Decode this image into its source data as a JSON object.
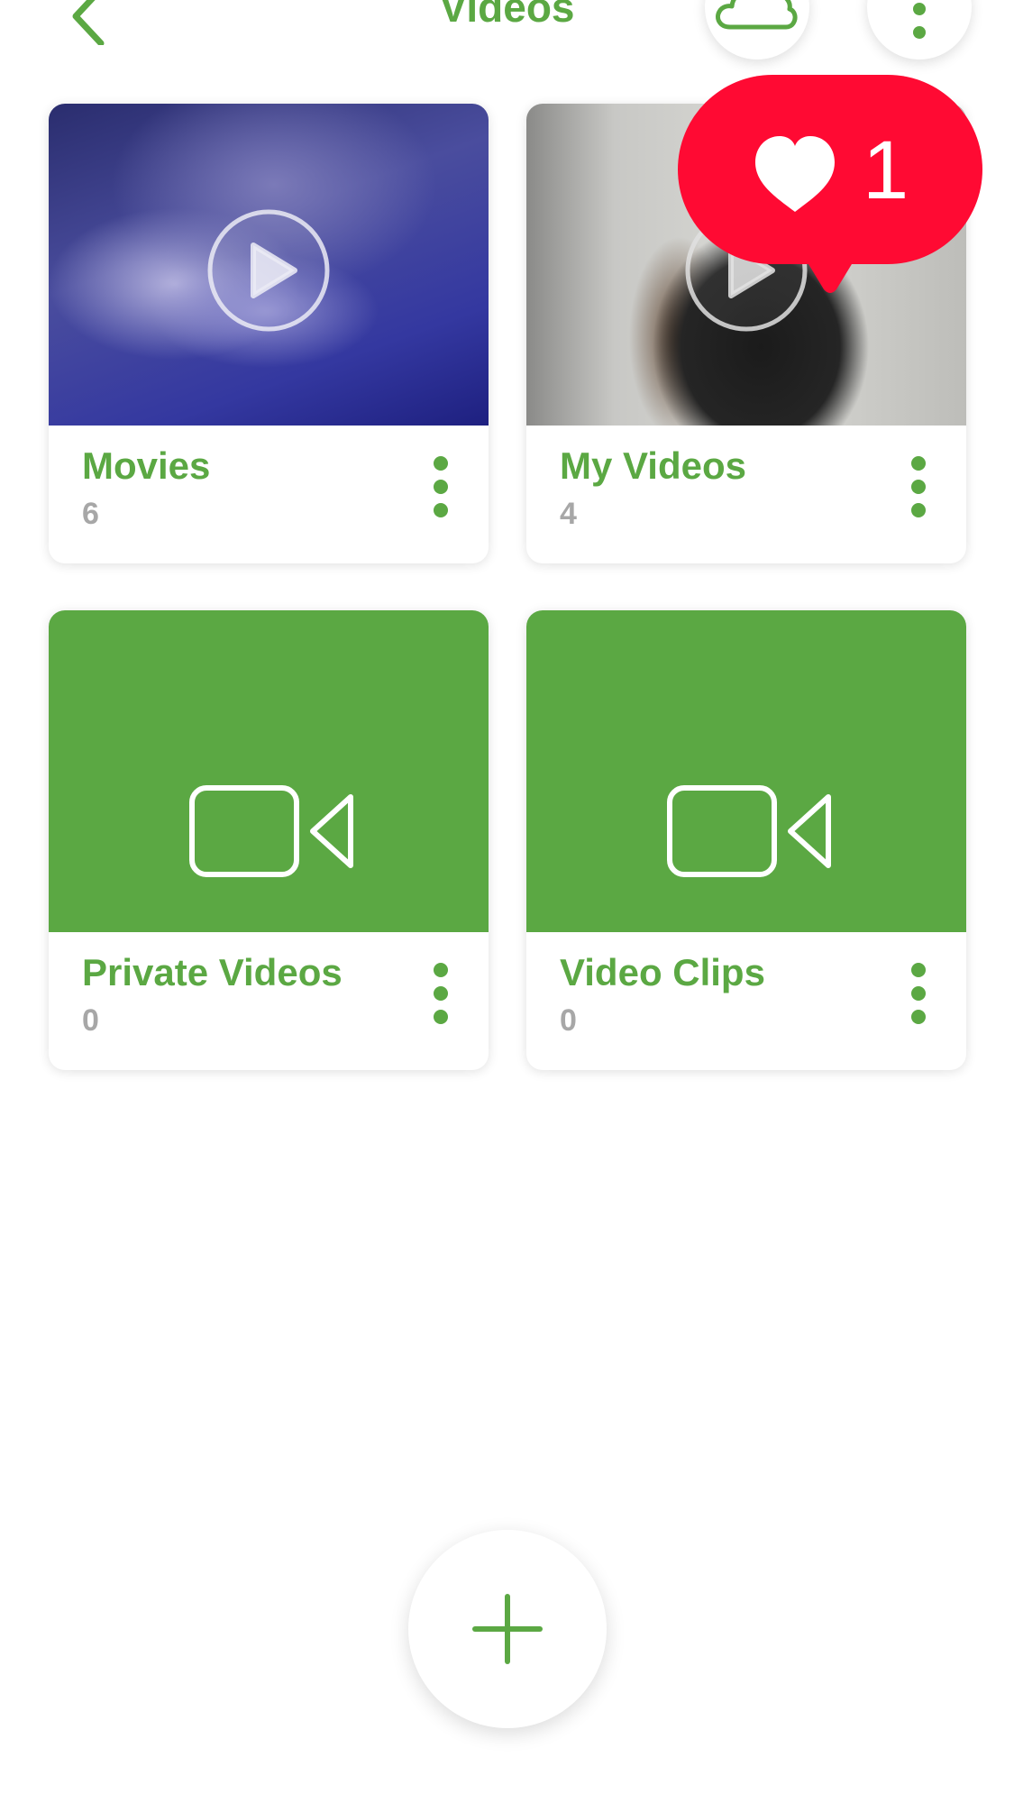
{
  "header": {
    "title": "Videos",
    "icons": {
      "back": "chevron-left-icon",
      "cloud": "cloud-icon",
      "more": "more-vertical-icon"
    }
  },
  "albums": [
    {
      "title": "Movies",
      "count": "6",
      "thumbnail": "video-frame",
      "icon": "play-icon"
    },
    {
      "title": "My Videos",
      "count": "4",
      "thumbnail": "video-frame",
      "icon": "play-icon"
    },
    {
      "title": "Private Videos",
      "count": "0",
      "thumbnail": "placeholder",
      "icon": "video-camera-icon"
    },
    {
      "title": "Video Clips",
      "count": "0",
      "thumbnail": "placeholder",
      "icon": "video-camera-icon"
    }
  ],
  "notification": {
    "icon": "heart-icon",
    "count": "1"
  },
  "fab": {
    "icon": "plus-icon"
  },
  "colors": {
    "accent": "#5ba843",
    "count_text": "#a7a7a7",
    "notification": "#ff0a33",
    "background": "#ffffff"
  }
}
